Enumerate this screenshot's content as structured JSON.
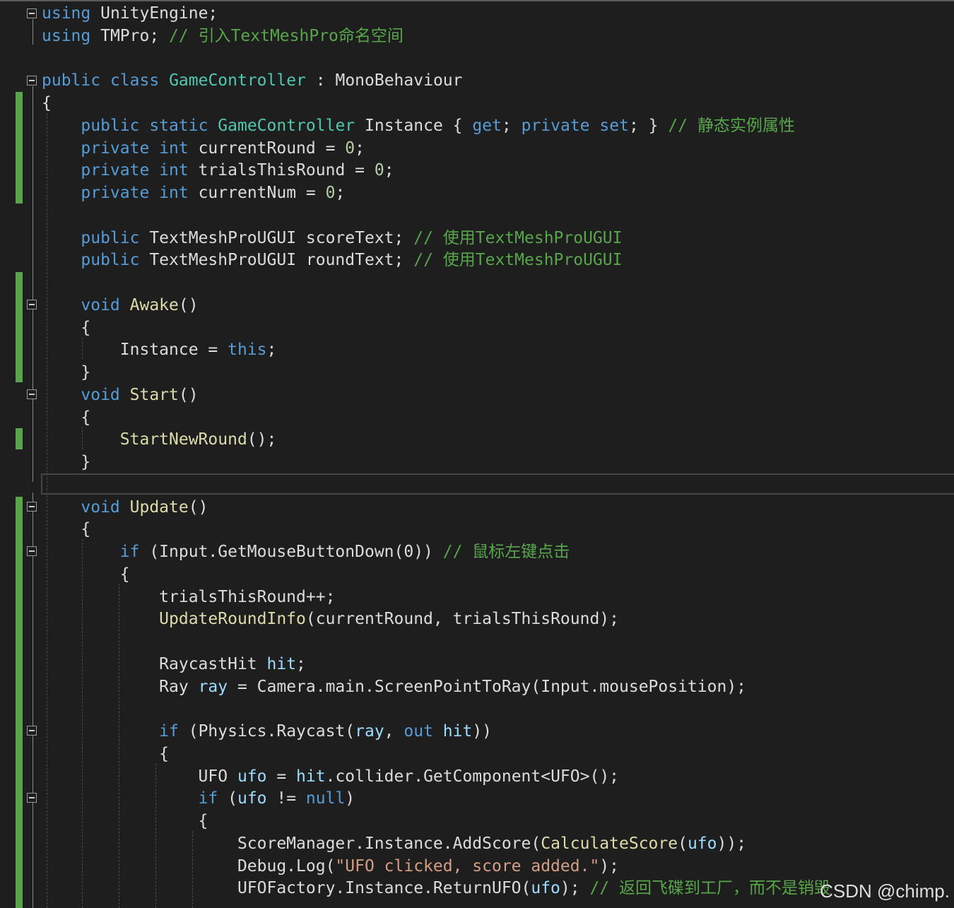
{
  "editor": {
    "lines": [
      {
        "tokens": [
          {
            "t": "using",
            "c": "kw"
          },
          {
            "t": " UnityEngine;",
            "c": "pl"
          }
        ]
      },
      {
        "tokens": [
          {
            "t": "using",
            "c": "kw"
          },
          {
            "t": " TMPro; ",
            "c": "pl"
          },
          {
            "t": "// 引入TextMeshPro命名空间",
            "c": "cm"
          }
        ]
      },
      {
        "tokens": []
      },
      {
        "tokens": [
          {
            "t": "public",
            "c": "kw"
          },
          {
            "t": " ",
            "c": "pl"
          },
          {
            "t": "class",
            "c": "kw"
          },
          {
            "t": " ",
            "c": "pl"
          },
          {
            "t": "GameController",
            "c": "ty"
          },
          {
            "t": " : MonoBehaviour",
            "c": "pl"
          }
        ]
      },
      {
        "tokens": [
          {
            "t": "{",
            "c": "pl"
          }
        ]
      },
      {
        "tokens": [
          {
            "t": "    ",
            "c": "pl"
          },
          {
            "t": "public",
            "c": "kw"
          },
          {
            "t": " ",
            "c": "pl"
          },
          {
            "t": "static",
            "c": "kw"
          },
          {
            "t": " ",
            "c": "pl"
          },
          {
            "t": "GameController",
            "c": "ty"
          },
          {
            "t": " Instance { ",
            "c": "pl"
          },
          {
            "t": "get",
            "c": "kw"
          },
          {
            "t": "; ",
            "c": "pl"
          },
          {
            "t": "private",
            "c": "kw"
          },
          {
            "t": " ",
            "c": "pl"
          },
          {
            "t": "set",
            "c": "kw"
          },
          {
            "t": "; } ",
            "c": "pl"
          },
          {
            "t": "// 静态实例属性",
            "c": "cm"
          }
        ]
      },
      {
        "tokens": [
          {
            "t": "    ",
            "c": "pl"
          },
          {
            "t": "private",
            "c": "kw"
          },
          {
            "t": " ",
            "c": "pl"
          },
          {
            "t": "int",
            "c": "kw"
          },
          {
            "t": " currentRound = ",
            "c": "pl"
          },
          {
            "t": "0",
            "c": "nm"
          },
          {
            "t": ";",
            "c": "pl"
          }
        ]
      },
      {
        "tokens": [
          {
            "t": "    ",
            "c": "pl"
          },
          {
            "t": "private",
            "c": "kw"
          },
          {
            "t": " ",
            "c": "pl"
          },
          {
            "t": "int",
            "c": "kw"
          },
          {
            "t": " trialsThisRound = ",
            "c": "pl"
          },
          {
            "t": "0",
            "c": "nm"
          },
          {
            "t": ";",
            "c": "pl"
          }
        ]
      },
      {
        "tokens": [
          {
            "t": "    ",
            "c": "pl"
          },
          {
            "t": "private",
            "c": "kw"
          },
          {
            "t": " ",
            "c": "pl"
          },
          {
            "t": "int",
            "c": "kw"
          },
          {
            "t": " currentNum = ",
            "c": "pl"
          },
          {
            "t": "0",
            "c": "nm"
          },
          {
            "t": ";",
            "c": "pl"
          }
        ]
      },
      {
        "tokens": []
      },
      {
        "tokens": [
          {
            "t": "    ",
            "c": "pl"
          },
          {
            "t": "public",
            "c": "kw"
          },
          {
            "t": " TextMeshProUGUI scoreText; ",
            "c": "pl"
          },
          {
            "t": "// 使用TextMeshProUGUI",
            "c": "cm"
          }
        ]
      },
      {
        "tokens": [
          {
            "t": "    ",
            "c": "pl"
          },
          {
            "t": "public",
            "c": "kw"
          },
          {
            "t": " TextMeshProUGUI roundText; ",
            "c": "pl"
          },
          {
            "t": "// 使用TextMeshProUGUI",
            "c": "cm"
          }
        ]
      },
      {
        "tokens": []
      },
      {
        "tokens": [
          {
            "t": "    ",
            "c": "pl"
          },
          {
            "t": "void",
            "c": "kw"
          },
          {
            "t": " ",
            "c": "pl"
          },
          {
            "t": "Awake",
            "c": "fn"
          },
          {
            "t": "()",
            "c": "pl"
          }
        ]
      },
      {
        "tokens": [
          {
            "t": "    {",
            "c": "pl"
          }
        ]
      },
      {
        "tokens": [
          {
            "t": "        Instance = ",
            "c": "pl"
          },
          {
            "t": "this",
            "c": "kw"
          },
          {
            "t": ";",
            "c": "pl"
          }
        ]
      },
      {
        "tokens": [
          {
            "t": "    }",
            "c": "pl"
          }
        ]
      },
      {
        "tokens": [
          {
            "t": "    ",
            "c": "pl"
          },
          {
            "t": "void",
            "c": "kw"
          },
          {
            "t": " ",
            "c": "pl"
          },
          {
            "t": "Start",
            "c": "fn"
          },
          {
            "t": "()",
            "c": "pl"
          }
        ]
      },
      {
        "tokens": [
          {
            "t": "    {",
            "c": "pl"
          }
        ]
      },
      {
        "tokens": [
          {
            "t": "        ",
            "c": "pl"
          },
          {
            "t": "StartNewRound",
            "c": "fn"
          },
          {
            "t": "();",
            "c": "pl"
          }
        ]
      },
      {
        "tokens": [
          {
            "t": "    }",
            "c": "pl"
          }
        ]
      },
      {
        "tokens": []
      },
      {
        "tokens": [
          {
            "t": "    ",
            "c": "pl"
          },
          {
            "t": "void",
            "c": "kw"
          },
          {
            "t": " ",
            "c": "pl"
          },
          {
            "t": "Update",
            "c": "fn"
          },
          {
            "t": "()",
            "c": "pl"
          }
        ]
      },
      {
        "tokens": [
          {
            "t": "    {",
            "c": "pl"
          }
        ]
      },
      {
        "tokens": [
          {
            "t": "        ",
            "c": "pl"
          },
          {
            "t": "if",
            "c": "kw"
          },
          {
            "t": " (Input.GetMouseButtonDown(0)) ",
            "c": "pl"
          },
          {
            "t": "// 鼠标左键点击",
            "c": "cm"
          }
        ]
      },
      {
        "tokens": [
          {
            "t": "        {",
            "c": "pl"
          }
        ]
      },
      {
        "tokens": [
          {
            "t": "            trialsThisRound++;",
            "c": "pl"
          }
        ]
      },
      {
        "tokens": [
          {
            "t": "            ",
            "c": "pl"
          },
          {
            "t": "UpdateRoundInfo",
            "c": "fn"
          },
          {
            "t": "(currentRound, trialsThisRound);",
            "c": "pl"
          }
        ]
      },
      {
        "tokens": []
      },
      {
        "tokens": [
          {
            "t": "            RaycastHit ",
            "c": "pl"
          },
          {
            "t": "hit",
            "c": "vr"
          },
          {
            "t": ";",
            "c": "pl"
          }
        ]
      },
      {
        "tokens": [
          {
            "t": "            Ray ",
            "c": "pl"
          },
          {
            "t": "ray",
            "c": "vr"
          },
          {
            "t": " = Camera.main.ScreenPointToRay(Input.mousePosition);",
            "c": "pl"
          }
        ]
      },
      {
        "tokens": []
      },
      {
        "tokens": [
          {
            "t": "            ",
            "c": "pl"
          },
          {
            "t": "if",
            "c": "kw"
          },
          {
            "t": " (Physics.Raycast(",
            "c": "pl"
          },
          {
            "t": "ray",
            "c": "vr"
          },
          {
            "t": ", ",
            "c": "pl"
          },
          {
            "t": "out",
            "c": "kw"
          },
          {
            "t": " ",
            "c": "pl"
          },
          {
            "t": "hit",
            "c": "vr"
          },
          {
            "t": "))",
            "c": "pl"
          }
        ]
      },
      {
        "tokens": [
          {
            "t": "            {",
            "c": "pl"
          }
        ]
      },
      {
        "tokens": [
          {
            "t": "                UFO ",
            "c": "pl"
          },
          {
            "t": "ufo",
            "c": "vr"
          },
          {
            "t": " = ",
            "c": "pl"
          },
          {
            "t": "hit",
            "c": "vr"
          },
          {
            "t": ".collider.GetComponent<UFO>();",
            "c": "pl"
          }
        ]
      },
      {
        "tokens": [
          {
            "t": "                ",
            "c": "pl"
          },
          {
            "t": "if",
            "c": "kw"
          },
          {
            "t": " (",
            "c": "pl"
          },
          {
            "t": "ufo",
            "c": "vr"
          },
          {
            "t": " != ",
            "c": "pl"
          },
          {
            "t": "null",
            "c": "kw"
          },
          {
            "t": ")",
            "c": "pl"
          }
        ]
      },
      {
        "tokens": [
          {
            "t": "                {",
            "c": "pl"
          }
        ]
      },
      {
        "tokens": [
          {
            "t": "                    ScoreManager.Instance.AddScore(",
            "c": "pl"
          },
          {
            "t": "CalculateScore",
            "c": "fn"
          },
          {
            "t": "(",
            "c": "pl"
          },
          {
            "t": "ufo",
            "c": "vr"
          },
          {
            "t": "));",
            "c": "pl"
          }
        ]
      },
      {
        "tokens": [
          {
            "t": "                    Debug.Log(",
            "c": "pl"
          },
          {
            "t": "\"UFO clicked, score added.\"",
            "c": "st"
          },
          {
            "t": ");",
            "c": "pl"
          }
        ]
      },
      {
        "tokens": [
          {
            "t": "                    UFOFactory.Instance.ReturnUFO(",
            "c": "pl"
          },
          {
            "t": "ufo",
            "c": "vr"
          },
          {
            "t": "); ",
            "c": "pl"
          },
          {
            "t": "// 返回飞碟到工厂，而不是销毁",
            "c": "cm"
          }
        ]
      }
    ]
  },
  "watermark": "CSDN @chimp.",
  "colors": {
    "background": "#1e1e1e",
    "keyword": "#569cd6",
    "type": "#4ec9b0",
    "method": "#dcdcaa",
    "comment": "#57a64a",
    "string": "#d69d85",
    "text": "#dcdcdc",
    "change_bar": "#57a64a"
  }
}
